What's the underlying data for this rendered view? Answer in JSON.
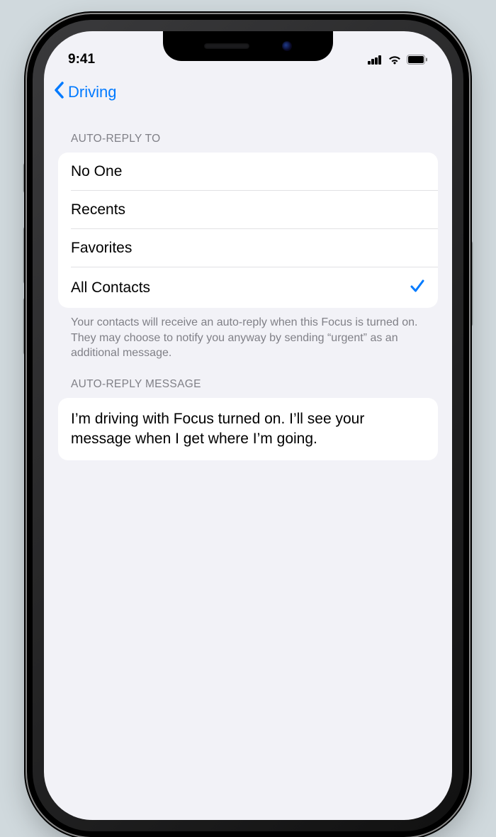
{
  "statusBar": {
    "time": "9:41"
  },
  "nav": {
    "backLabel": "Driving"
  },
  "sections": {
    "autoReplyTo": {
      "header": "Auto-Reply To",
      "options": [
        {
          "label": "No One",
          "selected": false
        },
        {
          "label": "Recents",
          "selected": false
        },
        {
          "label": "Favorites",
          "selected": false
        },
        {
          "label": "All Contacts",
          "selected": true
        }
      ],
      "footer": "Your contacts will receive an auto-reply when this Focus is turned on. They may choose to notify you anyway by sending “urgent” as an additional message."
    },
    "autoReplyMessage": {
      "header": "Auto-Reply Message",
      "message": "I’m driving with Focus turned on. I’ll see your message when I get where I’m going."
    }
  }
}
